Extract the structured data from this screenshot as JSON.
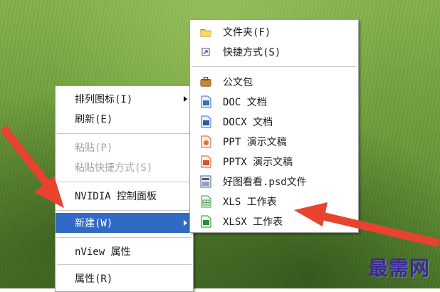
{
  "context_menu": {
    "items": [
      {
        "label": "排列图标(I)",
        "has_submenu": true,
        "disabled": false
      },
      {
        "label": "刷新(E)",
        "has_submenu": false,
        "disabled": false
      },
      {
        "label": "粘贴(P)",
        "has_submenu": false,
        "disabled": true
      },
      {
        "label": "粘贴快捷方式(S)",
        "has_submenu": false,
        "disabled": true
      },
      {
        "label": "NVIDIA 控制面板",
        "has_submenu": false,
        "disabled": false
      },
      {
        "label": "新建(W)",
        "has_submenu": true,
        "disabled": false,
        "highlighted": true
      },
      {
        "label": "nView 属性",
        "has_submenu": false,
        "disabled": false
      },
      {
        "label": "属性(R)",
        "has_submenu": false,
        "disabled": false
      }
    ]
  },
  "new_submenu": {
    "items": [
      {
        "label": "文件夹(F)",
        "icon": "folder-icon"
      },
      {
        "label": "快捷方式(S)",
        "icon": "shortcut-icon"
      },
      {
        "label": "公文包",
        "icon": "briefcase-icon"
      },
      {
        "label": "DOC 文档",
        "icon": "doc-file-icon"
      },
      {
        "label": "DOCX 文档",
        "icon": "docx-file-icon"
      },
      {
        "label": "PPT 演示文稿",
        "icon": "ppt-file-icon"
      },
      {
        "label": "PPTX 演示文稿",
        "icon": "pptx-file-icon"
      },
      {
        "label": "好图看看.psd文件",
        "icon": "psd-file-icon"
      },
      {
        "label": "XLS 工作表",
        "icon": "xls-file-icon"
      },
      {
        "label": "XLSX 工作表",
        "icon": "xlsx-file-icon"
      }
    ]
  },
  "watermark": "最需网",
  "colors": {
    "highlight": "#316ac5",
    "arrow": "#e8432e",
    "watermark": "#3a2a9a"
  }
}
